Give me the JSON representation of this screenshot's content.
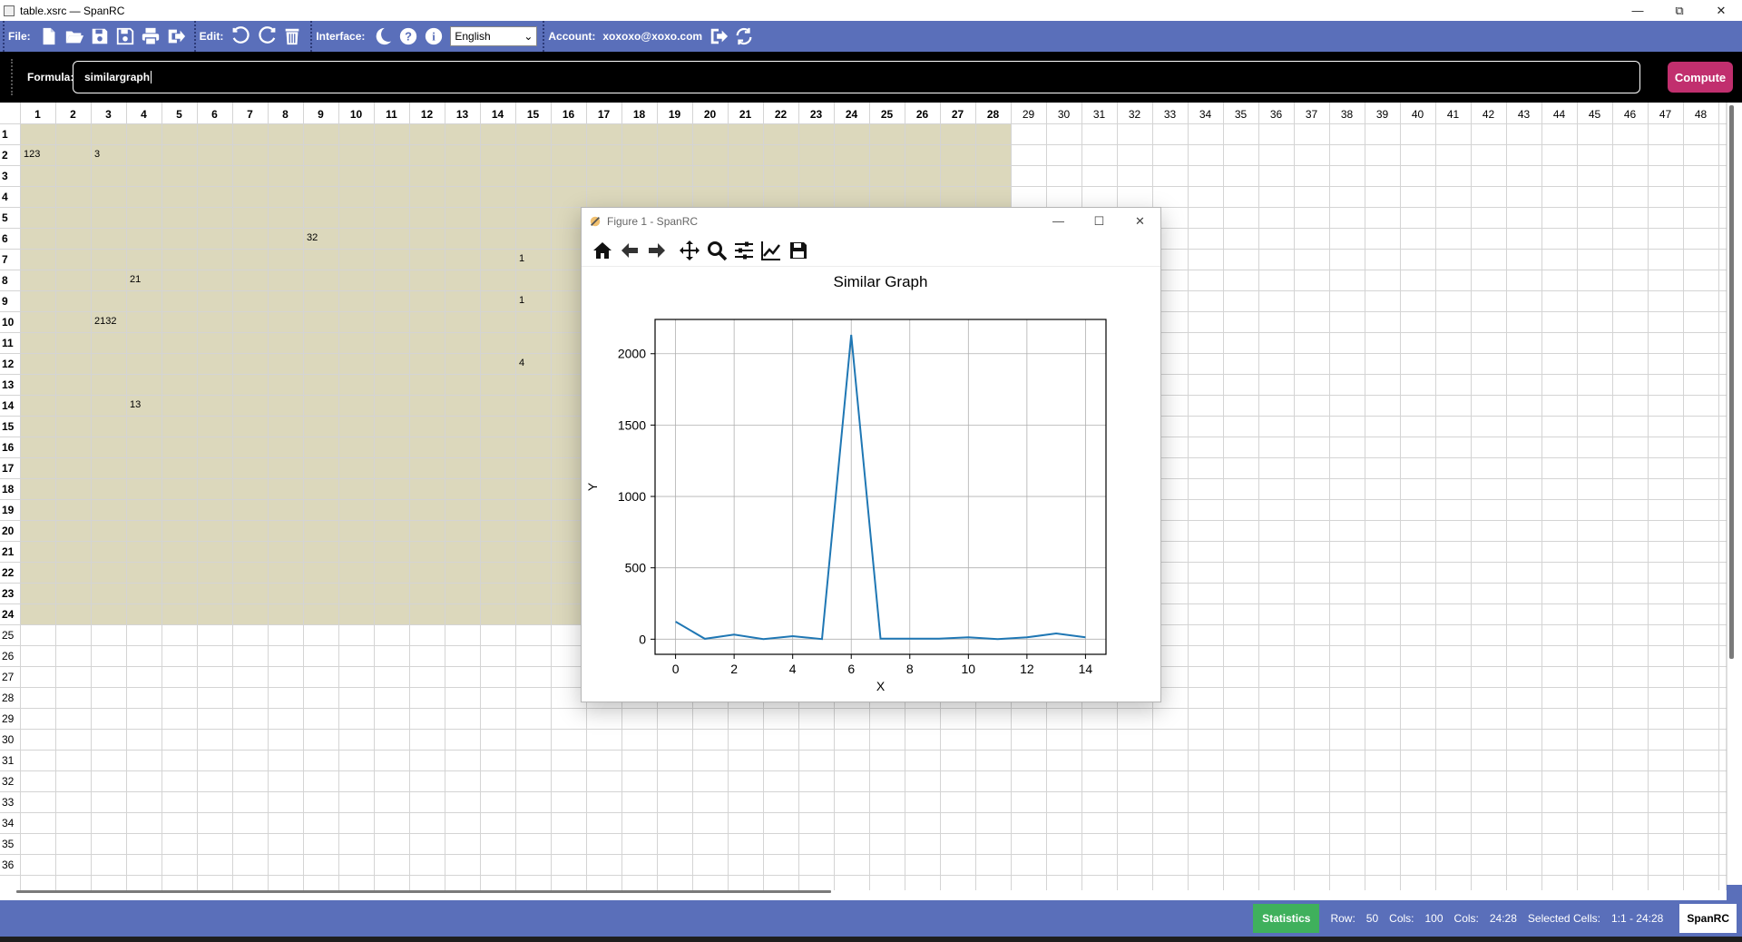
{
  "window": {
    "title": "table.xsrc — SpanRC"
  },
  "toolbar": {
    "file_label": "File:",
    "edit_label": "Edit:",
    "interface_label": "Interface:",
    "language": "English",
    "account_label": "Account:",
    "account_email": "xoxoxo@xoxo.com"
  },
  "formula": {
    "label": "Formula:",
    "value": "similargraph",
    "compute_label": "Compute"
  },
  "sheet": {
    "selection_color": "#dcd8bc",
    "columns": [
      "1",
      "2",
      "3",
      "4",
      "5",
      "6",
      "7",
      "8",
      "9",
      "10",
      "11",
      "12",
      "13",
      "14",
      "15",
      "16",
      "17",
      "18",
      "19",
      "20",
      "21",
      "22",
      "23",
      "24",
      "25",
      "26",
      "27",
      "28",
      "29",
      "30",
      "31",
      "32",
      "33",
      "34",
      "35",
      "36",
      "37",
      "38",
      "39",
      "40",
      "41",
      "42",
      "43",
      "44",
      "45",
      "46",
      "47",
      "48"
    ],
    "rows": [
      "1",
      "2",
      "3",
      "4",
      "5",
      "6",
      "7",
      "8",
      "9",
      "10",
      "11",
      "12",
      "13",
      "14",
      "15",
      "16",
      "17",
      "18",
      "19",
      "20",
      "21",
      "22",
      "23",
      "24",
      "25",
      "26",
      "27",
      "28",
      "29",
      "30",
      "31",
      "32",
      "33",
      "34",
      "35",
      "36"
    ],
    "cells": [
      {
        "row": 2,
        "col": 1,
        "value": "123"
      },
      {
        "row": 2,
        "col": 3,
        "value": "3"
      },
      {
        "row": 6,
        "col": 9,
        "value": "32"
      },
      {
        "row": 7,
        "col": 15,
        "value": "1"
      },
      {
        "row": 8,
        "col": 4,
        "value": "21"
      },
      {
        "row": 9,
        "col": 15,
        "value": "1"
      },
      {
        "row": 10,
        "col": 3,
        "value": "2132"
      },
      {
        "row": 12,
        "col": 15,
        "value": "4"
      },
      {
        "row": 14,
        "col": 4,
        "value": "13"
      }
    ],
    "selection": {
      "from_row": 1,
      "from_col": 1,
      "to_row": 24,
      "to_col": 28
    }
  },
  "figure": {
    "title": "Figure 1 - SpanRC",
    "toolbar_icons": [
      "home-icon",
      "back-icon",
      "forward-icon",
      "pan-icon",
      "zoom-icon",
      "configure-subplots-icon",
      "edit-axis-icon",
      "save-figure-icon"
    ]
  },
  "chart_data": {
    "type": "line",
    "title": "Similar Graph",
    "xlabel": "X",
    "ylabel": "Y",
    "x": [
      0,
      1,
      2,
      3,
      4,
      5,
      6,
      7,
      8,
      9,
      10,
      11,
      12,
      13,
      14
    ],
    "series": [
      {
        "values": [
          123,
          3,
          32,
          1,
          21,
          1,
          2132,
          4,
          4,
          4,
          13,
          1,
          13,
          40,
          13
        ],
        "color": "#1f77b4"
      }
    ],
    "xlim": [
      -0.7,
      14.7
    ],
    "ylim": [
      -106,
      2240
    ],
    "xticks": [
      0,
      2,
      4,
      6,
      8,
      10,
      12,
      14
    ],
    "yticks": [
      0,
      500,
      1000,
      1500,
      2000
    ],
    "grid": true
  },
  "statusbar": {
    "statistics_label": "Statistics",
    "row_label": "Row:",
    "row_value": "50",
    "cols_label": "Cols:",
    "cols_value": "100",
    "cols2_label": "Cols:",
    "cols2_value": "24:28",
    "selected_label": "Selected Cells:",
    "selected_value": "1:1 - 24:28",
    "brand": "SpanRC"
  },
  "colors": {
    "toolbar_bg": "#5a6fba",
    "compute_bg": "#c12f6e",
    "statistics_bg": "#3fb05c",
    "line": "#1f77b4"
  }
}
